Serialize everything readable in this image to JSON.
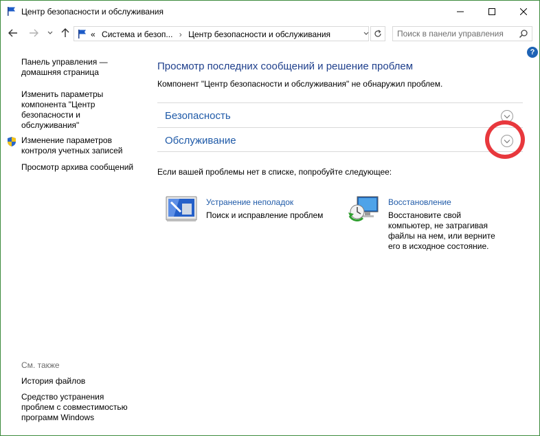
{
  "window": {
    "title": "Центр безопасности и обслуживания"
  },
  "address": {
    "prefix": "«",
    "crumb1": "Система и безоп...",
    "crumb2": "Центр безопасности и обслуживания"
  },
  "search": {
    "placeholder": "Поиск в панели управления"
  },
  "help": {
    "label": "?"
  },
  "sidebar": {
    "items": [
      {
        "label": "Панель управления — домашняя страница"
      },
      {
        "label": "Изменить параметры компонента \"Центр безопасности и обслуживания\""
      },
      {
        "label": "Изменение параметров контроля учетных записей"
      },
      {
        "label": "Просмотр архива сообщений"
      }
    ],
    "see_also_title": "См. также",
    "see_also": [
      {
        "label": "История файлов"
      },
      {
        "label": "Средство устранения проблем с совместимостью программ Windows"
      }
    ]
  },
  "main": {
    "heading": "Просмотр последних сообщений и решение проблем",
    "subtext": "Компонент \"Центр безопасности и обслуживания\" не обнаружил проблем.",
    "sections": [
      {
        "label": "Безопасность"
      },
      {
        "label": "Обслуживание"
      }
    ],
    "try_text": "Если вашей проблемы нет в списке, попробуйте следующее:",
    "tools": [
      {
        "name": "Устранение неполадок",
        "desc": "Поиск и исправление проблем"
      },
      {
        "name": "Восстановление",
        "desc": "Восстановите свой компьютер, не затрагивая файлы на нем, или верните его в исходное состояние."
      }
    ]
  },
  "colors": {
    "heading": "#1e3f8c",
    "link": "#1f5aa8",
    "highlight": "#e8383d",
    "border": "#3c8a3c"
  }
}
